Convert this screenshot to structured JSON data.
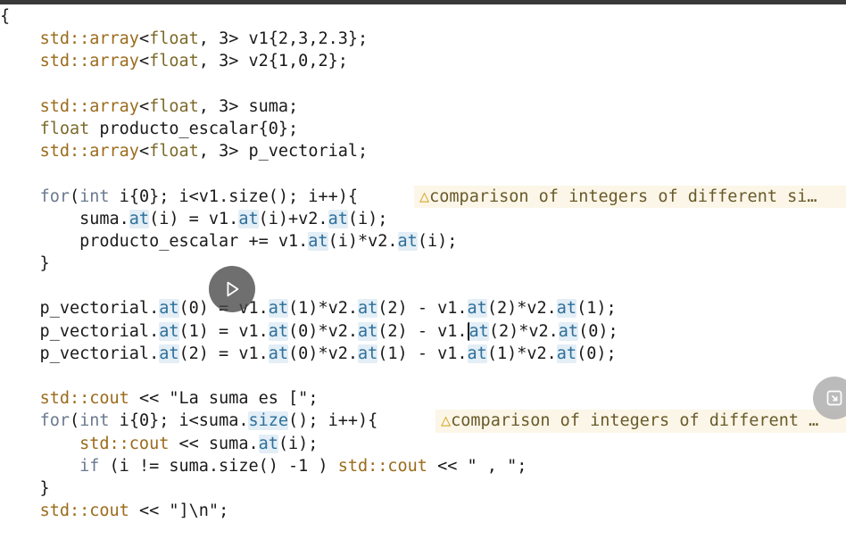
{
  "editor": {
    "lines": [
      [
        {
          "t": "{",
          "c": "id"
        }
      ],
      [
        {
          "t": "    "
        },
        {
          "t": "std::array",
          "c": "ns"
        },
        {
          "t": "<"
        },
        {
          "t": "float",
          "c": "type"
        },
        {
          "t": ", 3> v1{2,3,2.3};"
        }
      ],
      [
        {
          "t": "    "
        },
        {
          "t": "std::array",
          "c": "ns"
        },
        {
          "t": "<"
        },
        {
          "t": "float",
          "c": "type"
        },
        {
          "t": ", 3> v2{1,0,2};"
        }
      ],
      [
        {
          "t": ""
        }
      ],
      [
        {
          "t": "    "
        },
        {
          "t": "std::array",
          "c": "ns"
        },
        {
          "t": "<"
        },
        {
          "t": "float",
          "c": "type"
        },
        {
          "t": ", 3> suma;"
        }
      ],
      [
        {
          "t": "    "
        },
        {
          "t": "float",
          "c": "type"
        },
        {
          "t": " producto_escalar{0};"
        }
      ],
      [
        {
          "t": "    "
        },
        {
          "t": "std::array",
          "c": "ns"
        },
        {
          "t": "<"
        },
        {
          "t": "float",
          "c": "type"
        },
        {
          "t": ", 3> p_vectorial;"
        }
      ],
      [
        {
          "t": ""
        }
      ],
      [
        {
          "t": "    "
        },
        {
          "t": "for",
          "c": "kw"
        },
        {
          "t": "("
        },
        {
          "t": "int",
          "c": "kw"
        },
        {
          "t": " i{0}; i<v1.size(); i++){"
        }
      ],
      [
        {
          "t": "        suma."
        },
        {
          "t": "at",
          "c": "hl"
        },
        {
          "t": "(i) = v1."
        },
        {
          "t": "at",
          "c": "hl"
        },
        {
          "t": "(i)+v2."
        },
        {
          "t": "at",
          "c": "hl"
        },
        {
          "t": "(i);"
        }
      ],
      [
        {
          "t": "        producto_escalar += v1."
        },
        {
          "t": "at",
          "c": "hl"
        },
        {
          "t": "(i)*v2."
        },
        {
          "t": "at",
          "c": "hl"
        },
        {
          "t": "(i);"
        }
      ],
      [
        {
          "t": "    }"
        }
      ],
      [
        {
          "t": ""
        }
      ],
      [
        {
          "t": "    p_vectorial."
        },
        {
          "t": "at",
          "c": "hl"
        },
        {
          "t": "(0) = v1."
        },
        {
          "t": "at",
          "c": "hl"
        },
        {
          "t": "(1)*v2."
        },
        {
          "t": "at",
          "c": "hl"
        },
        {
          "t": "(2) - v1."
        },
        {
          "t": "at",
          "c": "hl"
        },
        {
          "t": "(2)*v2."
        },
        {
          "t": "at",
          "c": "hl"
        },
        {
          "t": "(1);"
        }
      ],
      [
        {
          "t": "    p_vectorial."
        },
        {
          "t": "at",
          "c": "hl"
        },
        {
          "t": "(1) = v1."
        },
        {
          "t": "at",
          "c": "hl"
        },
        {
          "t": "(0)*v2."
        },
        {
          "t": "at",
          "c": "hl"
        },
        {
          "t": "(2) - v1."
        },
        {
          "t": "at",
          "c": "hl cursor"
        },
        {
          "t": "(2)*v2."
        },
        {
          "t": "at",
          "c": "hl"
        },
        {
          "t": "(0);"
        }
      ],
      [
        {
          "t": "    p_vectorial."
        },
        {
          "t": "at",
          "c": "hl"
        },
        {
          "t": "(2) = v1."
        },
        {
          "t": "at",
          "c": "hl"
        },
        {
          "t": "(0)*v2."
        },
        {
          "t": "at",
          "c": "hl"
        },
        {
          "t": "(1) - v1."
        },
        {
          "t": "at",
          "c": "hl"
        },
        {
          "t": "(1)*v2."
        },
        {
          "t": "at",
          "c": "hl"
        },
        {
          "t": "(0);"
        }
      ],
      [
        {
          "t": ""
        }
      ],
      [
        {
          "t": "    "
        },
        {
          "t": "std::cout",
          "c": "ns"
        },
        {
          "t": " << "
        },
        {
          "t": "\"La suma es [\"",
          "c": "str"
        },
        {
          "t": ";"
        }
      ],
      [
        {
          "t": "    "
        },
        {
          "t": "for",
          "c": "kw"
        },
        {
          "t": "("
        },
        {
          "t": "int",
          "c": "kw"
        },
        {
          "t": " i{0}; i<suma."
        },
        {
          "t": "size",
          "c": "hl"
        },
        {
          "t": "(); i++){"
        }
      ],
      [
        {
          "t": "        "
        },
        {
          "t": "std::cout",
          "c": "ns"
        },
        {
          "t": " << suma."
        },
        {
          "t": "at",
          "c": "hl"
        },
        {
          "t": "(i);"
        }
      ],
      [
        {
          "t": "        "
        },
        {
          "t": "if",
          "c": "kw"
        },
        {
          "t": " (i != suma.size() -1 ) "
        },
        {
          "t": "std::cout",
          "c": "ns"
        },
        {
          "t": " << "
        },
        {
          "t": "\" , \"",
          "c": "str"
        },
        {
          "t": ";"
        }
      ],
      [
        {
          "t": "    }"
        }
      ],
      [
        {
          "t": "    "
        },
        {
          "t": "std::cout",
          "c": "ns"
        },
        {
          "t": " << "
        },
        {
          "t": "\"]\\n\"",
          "c": "str"
        },
        {
          "t": ";"
        }
      ]
    ],
    "warnings": [
      {
        "line": 8,
        "text": "comparison of integers of different si…"
      },
      {
        "line": 18,
        "text": "comparison of integers of different …"
      }
    ]
  },
  "overlay": {
    "play_icon": "play-icon",
    "side_icon": "exit-fullscreen-icon"
  }
}
